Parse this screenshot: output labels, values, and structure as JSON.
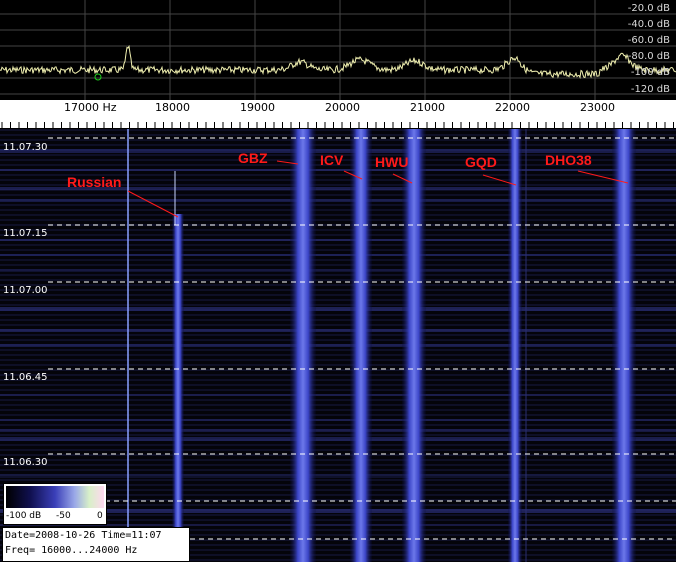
{
  "spectrum": {
    "db_labels": [
      "-20.0 dB",
      "-40.0 dB",
      "-60.0 dB",
      "-80.0 dB",
      "-100 dB",
      "-120 dB"
    ]
  },
  "frequency_scale": {
    "labels": [
      "17000 Hz",
      "18000",
      "19000",
      "20000",
      "21000",
      "22000",
      "23000"
    ]
  },
  "waterfall": {
    "time_labels": [
      "11.07.30",
      "11.07.15",
      "11.07.00",
      "11.06.45",
      "11.06.30"
    ],
    "stations": [
      "GBZ",
      "ICV",
      "HWU",
      "GQD",
      "DHO38",
      "Russian"
    ]
  },
  "color_scale": {
    "min_label": "-100 dB",
    "mid_label": "-50",
    "max_label": "0"
  },
  "info": {
    "line1": "Date=2008-10-26 Time=11:07",
    "line2": "Freq= 16000...24000 Hz"
  },
  "colors": {
    "trace": "#f0f0b0",
    "signal_blue": "#5a66e0",
    "annotation_red": "#ff1a1a",
    "marker_green": "#1cd21c"
  }
}
